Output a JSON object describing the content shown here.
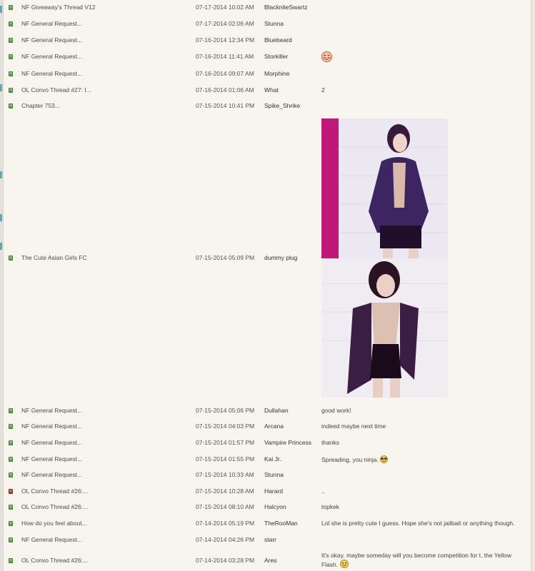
{
  "colors": {
    "background": "#f7f5ee",
    "status_open": "#5aa84c",
    "status_closed": "#c0443a",
    "accent_magenta": "#c0187a"
  },
  "rows": [
    {
      "thread": "NF Giveaway's Thread V12",
      "date": "07-17-2014 10:02 AM",
      "user": "BlackniteSwartz",
      "post": "",
      "status": "open"
    },
    {
      "thread": "NF General Request...",
      "date": "07-17-2014 02:06 AM",
      "user": "Stunna",
      "post": "",
      "status": "open"
    },
    {
      "thread": "NF General Request...",
      "date": "07-16-2014 12:34 PM",
      "user": "Bluebeard",
      "post": "",
      "status": "open"
    },
    {
      "thread": "NF General Request...",
      "date": "07-16-2014 11:41 AM",
      "user": "Storkiller",
      "post": "",
      "status": "open",
      "emoji": "blushing-face-icon"
    },
    {
      "thread": "NF General Request...",
      "date": "07-16-2014 09:07 AM",
      "user": "Morphine",
      "post": "",
      "status": "open"
    },
    {
      "thread": "OL Convo Thread #27: I...",
      "date": "07-16-2014 01:06 AM",
      "user": "What",
      "post": "2",
      "status": "open"
    },
    {
      "thread": "Chapter 753...",
      "date": "07-15-2014 10:41 PM",
      "user": "Spike_Shrike",
      "post": "",
      "status": "open"
    },
    {
      "thread": "The Cute Asian Girls FC",
      "date": "07-15-2014 05:09 PM",
      "user": "dummy plug",
      "post": "",
      "status": "open",
      "images": 2
    },
    {
      "thread": "NF General Request...",
      "date": "07-15-2014 05:06 PM",
      "user": "Dullahan",
      "post": "good work!",
      "status": "open"
    },
    {
      "thread": "NF General Request...",
      "date": "07-15-2014 04:03 PM",
      "user": "Arcana",
      "post": "indeed maybe next time",
      "status": "open"
    },
    {
      "thread": "NF General Request...",
      "date": "07-15-2014 01:57 PM",
      "user": "Vampire Princess",
      "post": "thanks",
      "status": "open"
    },
    {
      "thread": "NF General Request...",
      "date": "07-15-2014 01:55 PM",
      "user": "Kai Jr.",
      "post": "Spreading, you ninja.",
      "status": "open",
      "emoji": "sunglasses-face-icon"
    },
    {
      "thread": "NF General Request...",
      "date": "07-15-2014 10:33 AM",
      "user": "Stunna",
      "post": "",
      "status": "open"
    },
    {
      "thread": "OL Convo Thread #26:...",
      "date": "07-15-2014 10:28 AM",
      "user": "Harard",
      "post": "..",
      "status": "closed"
    },
    {
      "thread": "OL Convo Thread #26:...",
      "date": "07-15-2014 08:10 AM",
      "user": "Halcyon",
      "post": "topkek",
      "status": "open"
    },
    {
      "thread": "How do you feel about...",
      "date": "07-14-2014 05:19 PM",
      "user": "TheRooMan",
      "post": "Lol she is pretty cute I guess. Hope she's not jailbait or anything though.",
      "status": "open"
    },
    {
      "thread": "NF General Request...",
      "date": "07-14-2014 04:26 PM",
      "user": "starr",
      "post": "",
      "status": "open"
    },
    {
      "thread": "OL Convo Thread #26:...",
      "date": "07-14-2014 03:28 PM",
      "user": "Ares",
      "post": "It's okay, maybe someday will you become competition for I, the Yellow Flash.",
      "status": "open",
      "emoji": "smiling-face-icon"
    }
  ]
}
